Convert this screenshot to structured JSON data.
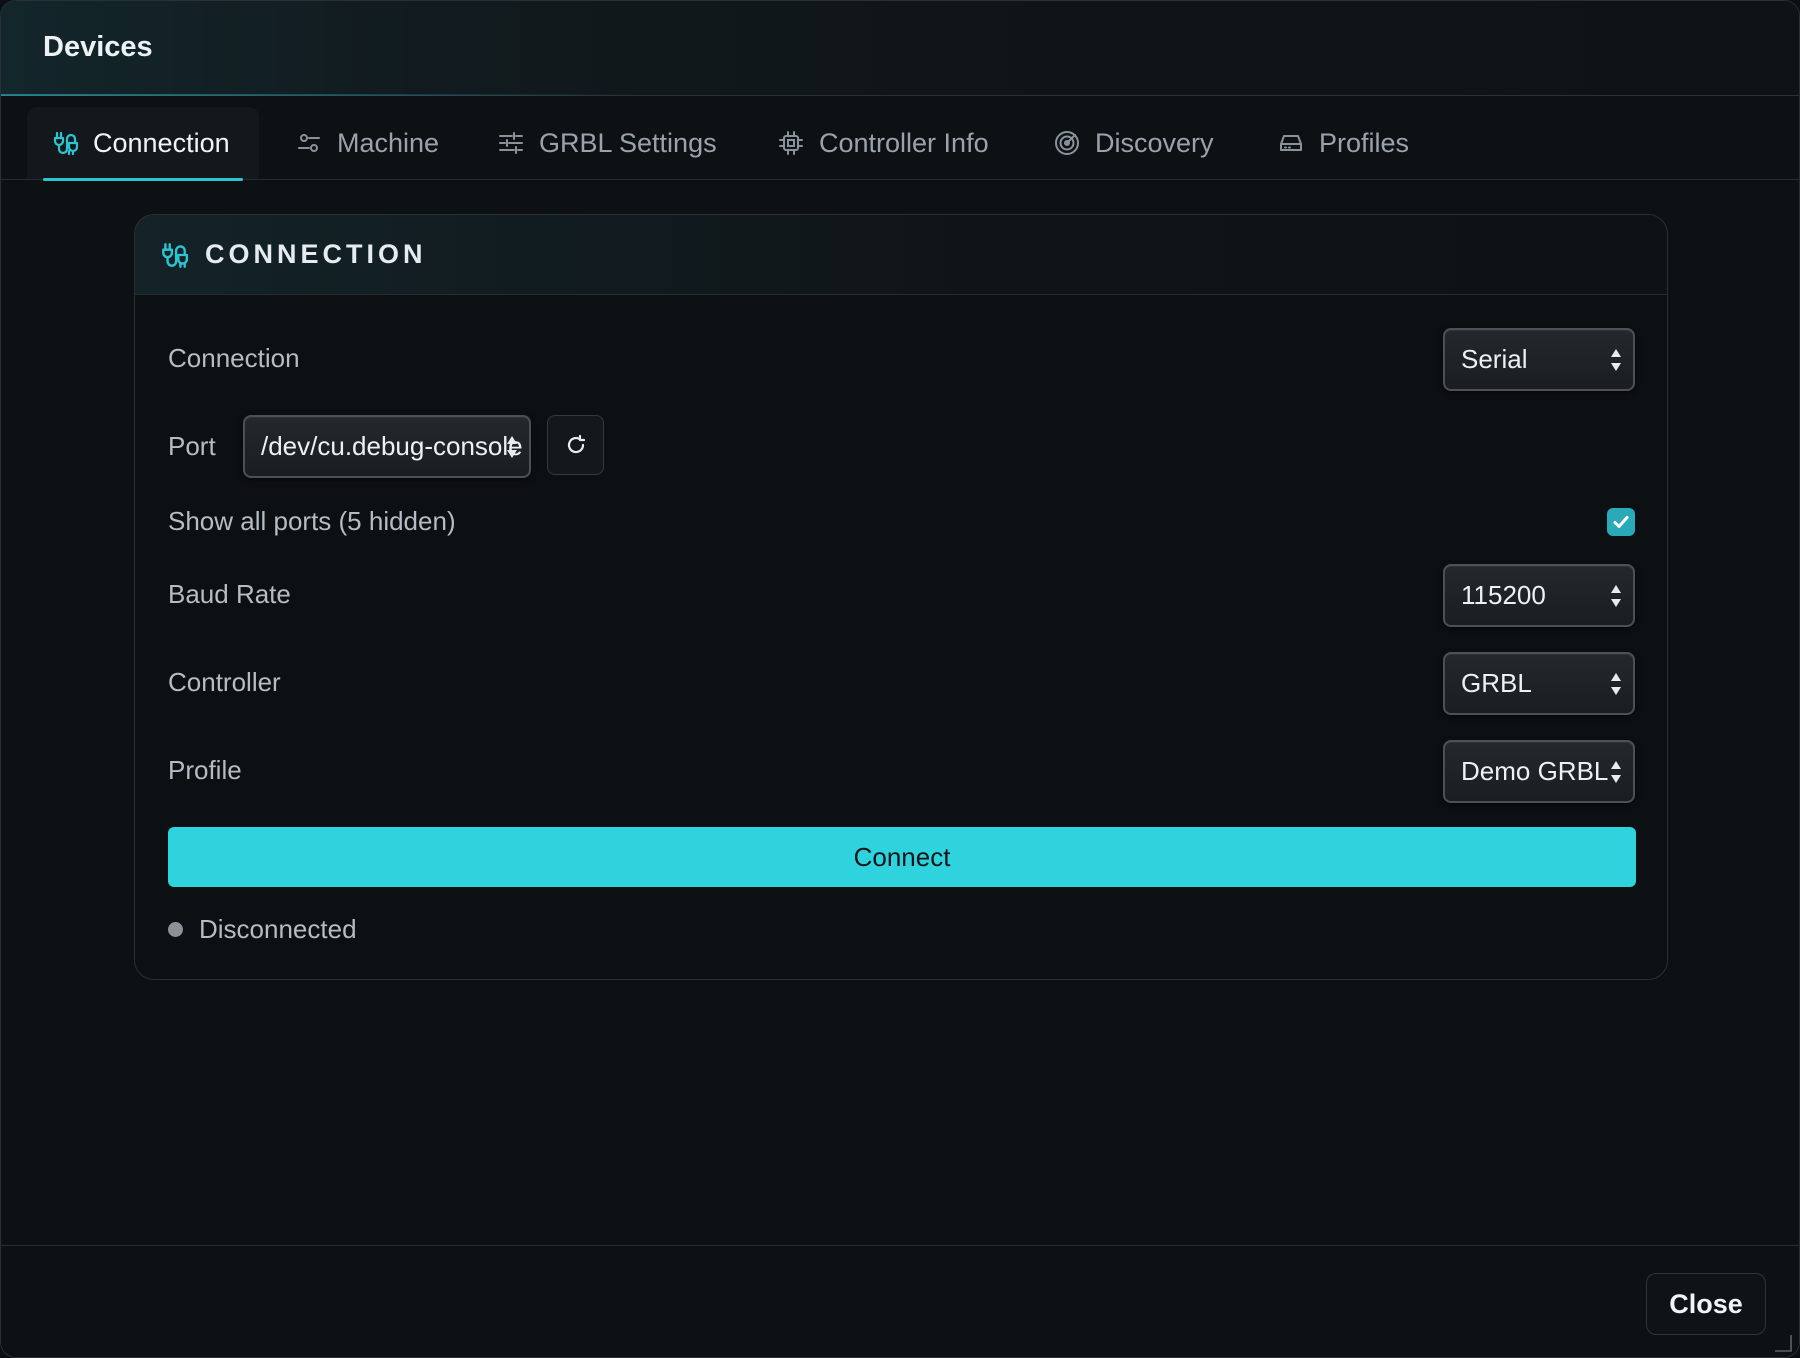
{
  "window": {
    "title": "Devices"
  },
  "tabs": [
    {
      "label": "Connection",
      "icon": "plug-icon",
      "active": true
    },
    {
      "label": "Machine",
      "icon": "sliders-icon",
      "active": false
    },
    {
      "label": "GRBL Settings",
      "icon": "adjustments-icon",
      "active": false
    },
    {
      "label": "Controller Info",
      "icon": "chip-icon",
      "active": false
    },
    {
      "label": "Discovery",
      "icon": "radar-icon",
      "active": false
    },
    {
      "label": "Profiles",
      "icon": "drive-icon",
      "active": false
    }
  ],
  "card": {
    "title": "CONNECTION",
    "connection": {
      "label": "Connection",
      "value": "Serial"
    },
    "port": {
      "label": "Port",
      "value": "/dev/cu.debug-console"
    },
    "show_all_ports": {
      "label": "Show all ports (5 hidden)",
      "checked": true
    },
    "baud_rate": {
      "label": "Baud Rate",
      "value": "115200"
    },
    "controller": {
      "label": "Controller",
      "value": "GRBL"
    },
    "profile": {
      "label": "Profile",
      "value": "Demo GRBL"
    },
    "connect_label": "Connect",
    "status": "Disconnected"
  },
  "footer": {
    "close_label": "Close"
  },
  "colors": {
    "accent": "#2fd3dd",
    "background": "#0e1114",
    "status_dot": "#8a9199"
  }
}
